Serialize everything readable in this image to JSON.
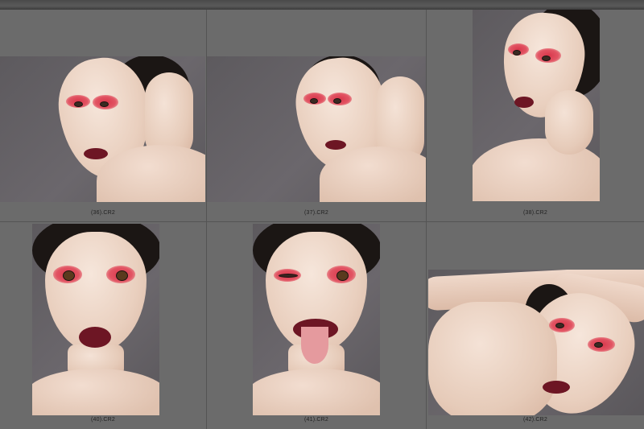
{
  "thumbnails": [
    {
      "caption": "(36).CR2"
    },
    {
      "caption": "(37).CR2"
    },
    {
      "caption": "(38).CR2"
    },
    {
      "caption": "(40).CR2"
    },
    {
      "caption": "(41).CR2"
    },
    {
      "caption": "(42).CR2"
    }
  ],
  "colors": {
    "background": "#6e6e6e",
    "grid_line": "#545454",
    "makeup_red": "#d8374b",
    "lip_color": "#6d1624"
  }
}
